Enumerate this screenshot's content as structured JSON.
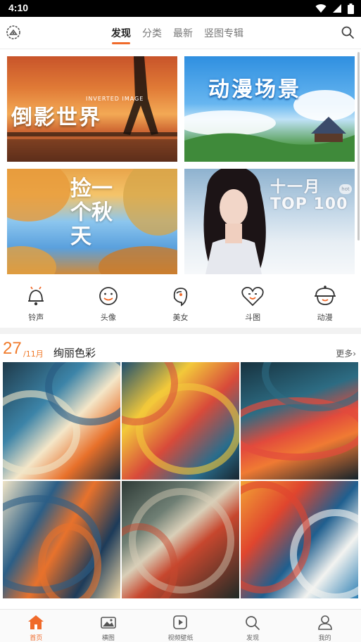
{
  "status": {
    "time": "4:10"
  },
  "header": {
    "tabs": [
      {
        "label": "发现",
        "active": true
      },
      {
        "label": "分类",
        "active": false
      },
      {
        "label": "最新",
        "active": false
      },
      {
        "label": "竖图专辑",
        "active": false
      }
    ]
  },
  "banners": [
    {
      "title": "倒影世界",
      "subtitle": "INVERTED IMAGE"
    },
    {
      "title": "动漫场景"
    },
    {
      "title": "捡一个秋天"
    },
    {
      "title": "十一月",
      "title2": "TOP 100",
      "badge": "hot"
    }
  ],
  "categories": [
    {
      "label": "铃声",
      "icon": "bell-icon"
    },
    {
      "label": "头像",
      "icon": "smiley-icon"
    },
    {
      "label": "美女",
      "icon": "woman-face-icon"
    },
    {
      "label": "斗图",
      "icon": "heart-face-icon"
    },
    {
      "label": "动漫",
      "icon": "anime-face-icon"
    }
  ],
  "section": {
    "day": "27",
    "month": "/11月",
    "title": "绚丽色彩",
    "more": "更多›"
  },
  "bottom_nav": [
    {
      "label": "首页",
      "icon": "home-icon",
      "active": true
    },
    {
      "label": "横图",
      "icon": "image-icon",
      "active": false
    },
    {
      "label": "视频壁纸",
      "icon": "video-icon",
      "active": false
    },
    {
      "label": "发现",
      "icon": "search-icon",
      "active": false
    },
    {
      "label": "我的",
      "icon": "user-icon",
      "active": false
    }
  ],
  "colors": {
    "accent": "#f06a2a",
    "section_accent": "#f07a2a"
  }
}
